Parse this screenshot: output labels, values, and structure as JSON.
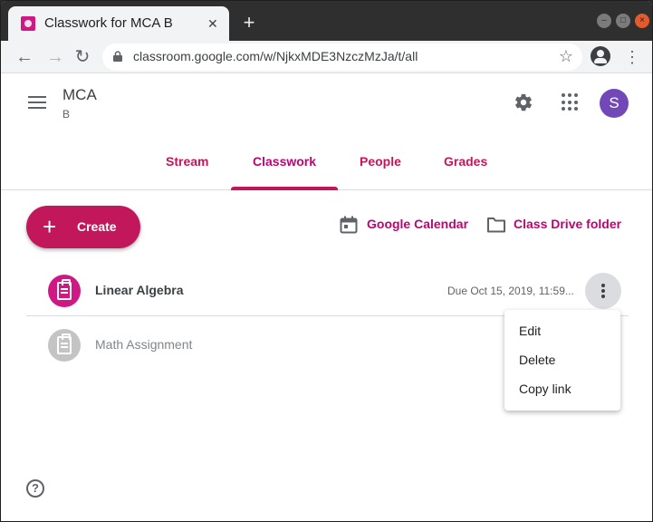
{
  "browser": {
    "tab_title": "Classwork for MCA B",
    "tab_close": "✕",
    "new_tab": "+",
    "url": "classroom.google.com/w/NjkxMDE3NzczMzJa/t/all",
    "back": "←",
    "forward": "→",
    "reload": "↻",
    "star": "☆",
    "menu": "⋮"
  },
  "header": {
    "class_name": "MCA",
    "section": "B",
    "avatar_letter": "S",
    "tabs": [
      {
        "label": "Stream"
      },
      {
        "label": "Classwork"
      },
      {
        "label": "People"
      },
      {
        "label": "Grades"
      }
    ],
    "active_tab": "Classwork"
  },
  "toolbar": {
    "create_label": "Create",
    "calendar_label": "Google Calendar",
    "drive_label": "Class Drive folder"
  },
  "items": [
    {
      "title": "Linear Algebra",
      "due": "Due Oct 15, 2019, 11:59..."
    },
    {
      "title": "Math Assignment"
    }
  ],
  "menu": {
    "items": [
      {
        "label": "Edit"
      },
      {
        "label": "Delete"
      },
      {
        "label": "Copy link"
      }
    ]
  },
  "help": "?",
  "colors": {
    "accent": "#c2185b",
    "avatar": "#7248b9",
    "item_icon": "#d01884"
  }
}
